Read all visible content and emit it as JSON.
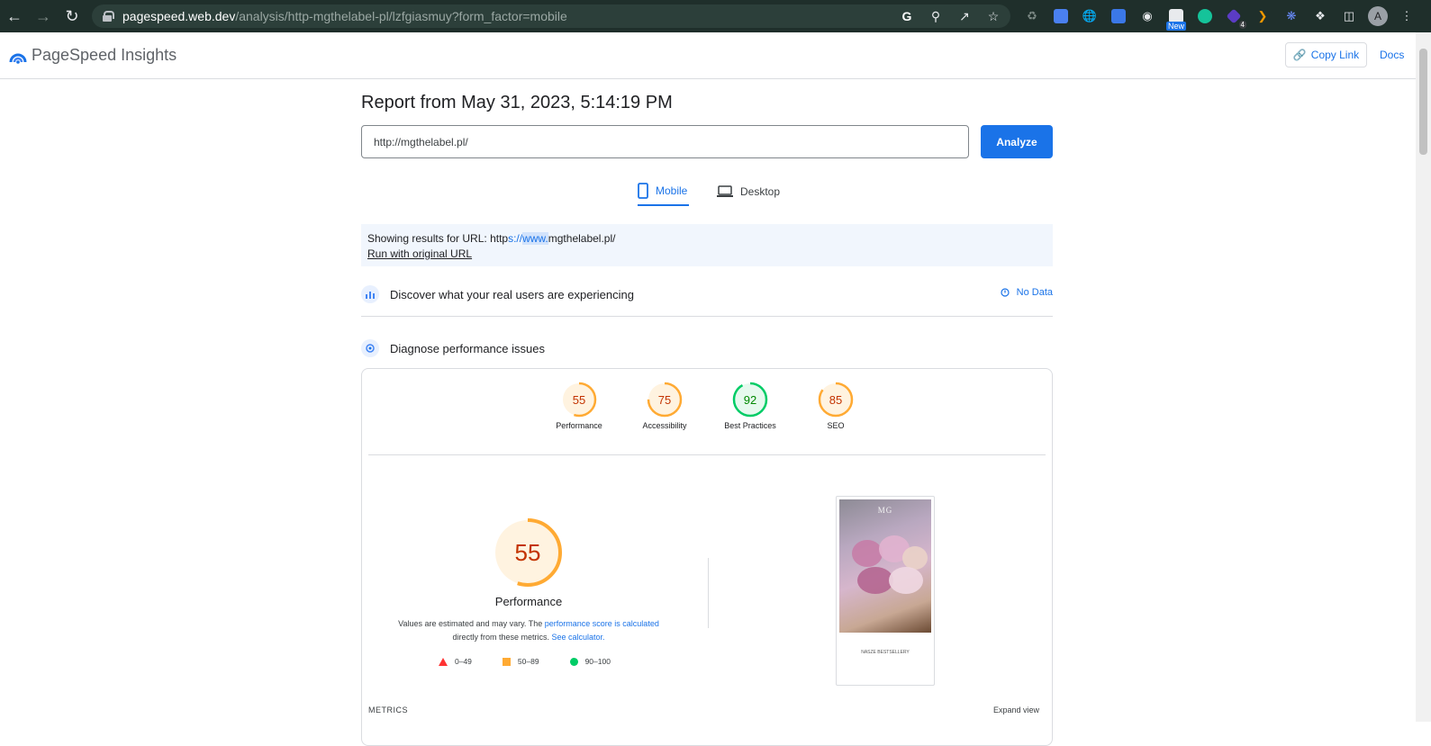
{
  "browser": {
    "url_host": "pagespeed.web.dev",
    "url_path": "/analysis/http-mgthelabel-pl/lzfgiasmuy?form_factor=mobile",
    "ext_new_badge": "New",
    "ext_count_badge": "4",
    "avatar_letter": "A"
  },
  "header": {
    "title": "PageSpeed Insights",
    "copy_link": "Copy Link",
    "docs": "Docs"
  },
  "report": {
    "title": "Report from May 31, 2023, 5:14:19 PM",
    "url_value": "http://mgthelabel.pl/",
    "analyze_label": "Analyze"
  },
  "tabs": {
    "mobile": "Mobile",
    "desktop": "Desktop"
  },
  "showing": {
    "prefix": "Showing results for URL: ",
    "url_a": "http",
    "url_b": "s://",
    "url_c": "www.",
    "url_d": "mgthelabel.pl/",
    "run_original": "Run with original URL"
  },
  "sections": {
    "discover": "Discover what your real users are experiencing",
    "no_data": "No Data",
    "diagnose": "Diagnose performance issues"
  },
  "scores": [
    {
      "label": "Performance",
      "value": "55",
      "fraction": 0.55,
      "color": "#fa3",
      "text_color": "#c33300",
      "bg": "#fff3e0"
    },
    {
      "label": "Accessibility",
      "value": "75",
      "fraction": 0.75,
      "color": "#fa3",
      "text_color": "#c33300",
      "bg": "#fff3e0"
    },
    {
      "label": "Best Practices",
      "value": "92",
      "fraction": 0.92,
      "color": "#0c6",
      "text_color": "#008800",
      "bg": "#e6f9ee"
    },
    {
      "label": "SEO",
      "value": "85",
      "fraction": 0.85,
      "color": "#fa3",
      "text_color": "#c33300",
      "bg": "#fff3e0"
    }
  ],
  "performance": {
    "score": "55",
    "title": "Performance",
    "desc_1": "Values are estimated and may vary. The ",
    "desc_link_1": "performance score is calculated",
    "desc_2": "directly from these metrics. ",
    "desc_link_2": "See calculator."
  },
  "legend": {
    "red": "0–49",
    "orange": "50–89",
    "green": "90–100",
    "red_color": "#ff3333",
    "orange_color": "#ffaa33",
    "green_color": "#00cc66"
  },
  "screenshot": {
    "logo": "MG",
    "caption": "NASZE BESTSELLERY"
  },
  "metrics": {
    "label": "METRICS",
    "expand": "Expand view"
  }
}
